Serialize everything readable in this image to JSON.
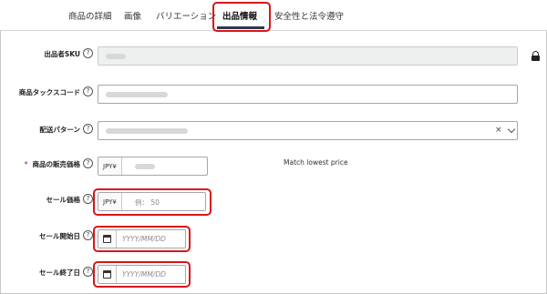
{
  "tabs": [
    {
      "label": "商品の詳細",
      "active": false
    },
    {
      "label": "画像",
      "active": false
    },
    {
      "label": "バリエーション",
      "active": false
    },
    {
      "label": "出品情報",
      "active": true
    },
    {
      "label": "安全性と法令遵守",
      "active": false
    }
  ],
  "form": {
    "seller_sku": {
      "label": "出品者SKU",
      "value": "",
      "locked": true
    },
    "product_tax_code": {
      "label": "商品タックスコード",
      "value": ""
    },
    "shipping_template": {
      "label": "配送パターン",
      "value": "",
      "clear_glyph": "×"
    },
    "sale_price": {
      "label": "商品の販売価格",
      "required_mark": "*",
      "currency": "JPY¥",
      "value": "",
      "match_link": "Match lowest price"
    },
    "sale_discount_price": {
      "label": "セール価格",
      "currency": "JPY¥",
      "placeholder": "例： 50"
    },
    "sale_start_date": {
      "label": "セール開始日",
      "placeholder": "YYYY/MM/DD"
    },
    "sale_end_date": {
      "label": "セール終了日",
      "placeholder": "YYYY/MM/DD"
    }
  },
  "help_glyph": "?",
  "colors": {
    "highlight": "#d9141b",
    "tab_underline": "#2b3a48",
    "disabled_bg": "#eef0f0"
  }
}
